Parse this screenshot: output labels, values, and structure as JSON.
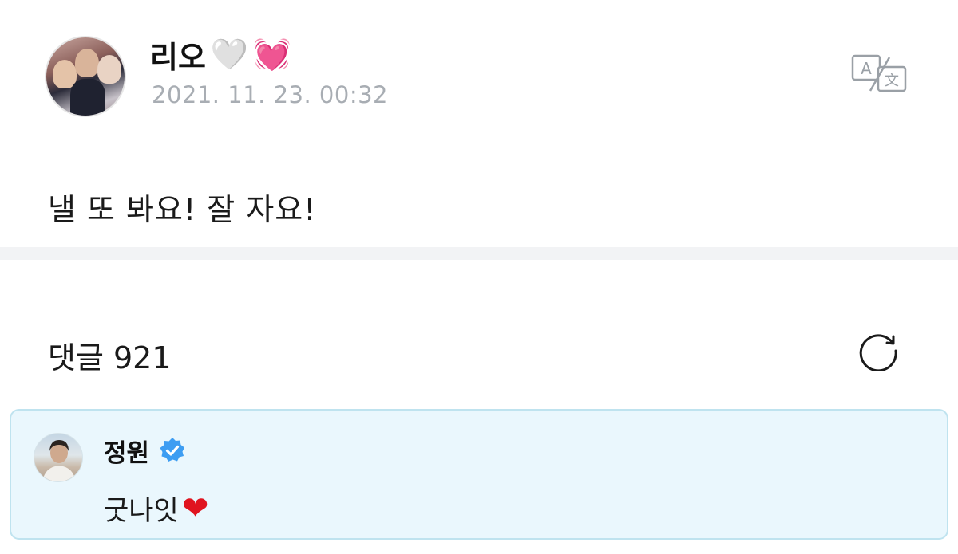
{
  "post": {
    "author_name": "리오",
    "author_emoji_1": "🤍",
    "author_emoji_2": "💓",
    "date": "2021. 11. 23. 00:32",
    "body": "낼 또 봐요! 잘 자요!",
    "translate_icon": "translate-icon"
  },
  "comments": {
    "count_label": "댓글 921",
    "refresh_icon": "refresh-icon",
    "items": [
      {
        "name": "정원",
        "verified_icon": "verified-badge-icon",
        "text": "굿나잇",
        "emoji": "❤"
      }
    ]
  },
  "colors": {
    "date_gray": "#a8adb3",
    "divider": "#f2f3f5",
    "comment_bg": "#eaf7fd",
    "comment_border": "#bfe3ef",
    "verified_blue": "#3d9df2",
    "heart_red": "#e0141f",
    "heart_pink": "#ff3e8e"
  }
}
